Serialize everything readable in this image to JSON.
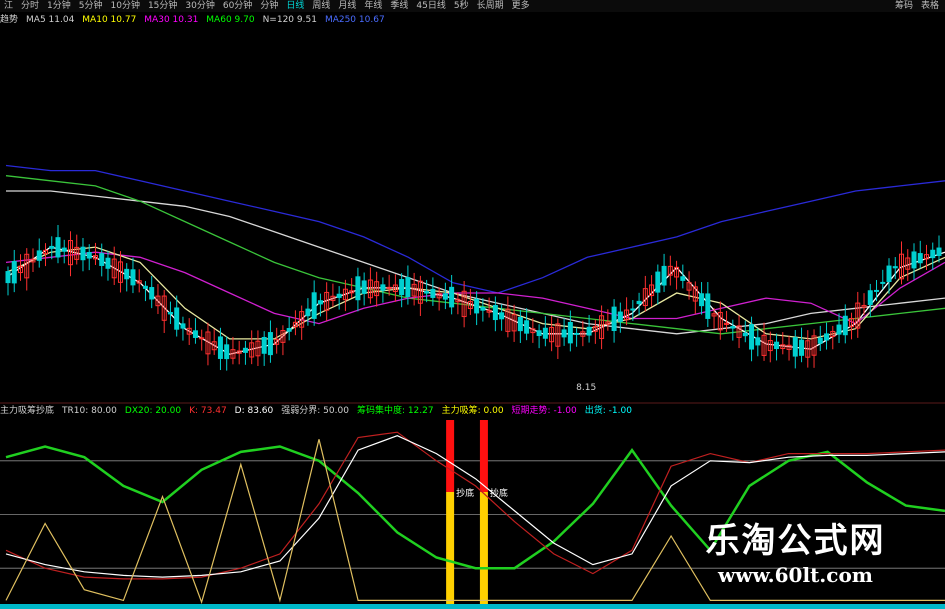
{
  "toolbar": {
    "items": [
      "江",
      "分时",
      "1分钟",
      "5分钟",
      "10分钟",
      "15分钟",
      "30分钟",
      "60分钟",
      "分钟",
      "日线",
      "周线",
      "月线",
      "年线",
      "季线",
      "45日线",
      "5秒",
      "长周期",
      "更多"
    ],
    "active_index": 9,
    "right_items": [
      "筹码",
      "表格"
    ]
  },
  "ma_legend": [
    {
      "label": "趋势",
      "color": "#d0d0d0"
    },
    {
      "label": "MA5 11.04",
      "color": "#d0d0d0"
    },
    {
      "label": "MA10 10.77",
      "color": "#ffff00"
    },
    {
      "label": "MA30 10.31",
      "color": "#ff00ff"
    },
    {
      "label": "MA60 9.70",
      "color": "#00ff00"
    },
    {
      "label": "N=120 9.51",
      "color": "#d0d0d0"
    },
    {
      "label": "MA250 10.67",
      "color": "#4a6cff"
    }
  ],
  "indicator_legend": [
    {
      "label": "主力吸筹抄底",
      "color": "#d0d0d0"
    },
    {
      "label": "TR10: 80.00",
      "color": "#d0d0d0"
    },
    {
      "label": "DX20: 20.00",
      "color": "#00ff00"
    },
    {
      "label": "K: 73.47",
      "color": "#ff3030"
    },
    {
      "label": "D: 83.60",
      "color": "#ffffff"
    },
    {
      "label": "强弱分界: 50.00",
      "color": "#d0d0d0"
    },
    {
      "label": "筹码集中度: 12.27",
      "color": "#00ff00"
    },
    {
      "label": "主力吸筹: 0.00",
      "color": "#ffff00"
    },
    {
      "label": "短期走势: -1.00",
      "color": "#ff00ff"
    },
    {
      "label": "出货: -1.00",
      "color": "#00ffff"
    }
  ],
  "chart_data": [
    {
      "type": "candlestick",
      "title": "",
      "annotations": [
        {
          "text": "8.15",
          "x": 62
        }
      ],
      "series": [
        {
          "name": "MA250",
          "color": "#2a2ad8",
          "values": [
            115,
            114,
            114,
            112,
            110,
            108,
            106,
            104,
            101,
            97,
            92,
            90,
            93,
            97,
            99,
            101,
            104,
            106,
            108,
            110,
            111,
            112
          ]
        },
        {
          "name": "N=120",
          "color": "#d8d8d8",
          "values": [
            110,
            110,
            109,
            108,
            107,
            105,
            102,
            99,
            96,
            93,
            90,
            88,
            86,
            84,
            83,
            82,
            83,
            84,
            86,
            87,
            88,
            89
          ]
        },
        {
          "name": "MA60",
          "color": "#3ac43a",
          "values": [
            113,
            112,
            111,
            108,
            104,
            100,
            96,
            93,
            91,
            89,
            88,
            87,
            86,
            85,
            84,
            83,
            82,
            83,
            84,
            85,
            86,
            87
          ]
        },
        {
          "name": "MA30",
          "color": "#d020d0",
          "values": [
            96,
            97,
            98,
            97,
            94,
            90,
            86,
            84,
            87,
            89,
            90,
            90,
            89,
            87,
            85,
            85,
            87,
            89,
            88,
            84,
            91,
            96
          ]
        },
        {
          "name": "MA10",
          "color": "#e8e8a0",
          "values": [
            94,
            98,
            99,
            96,
            87,
            81,
            81,
            86,
            90,
            91,
            90,
            87,
            84,
            83,
            85,
            90,
            88,
            82,
            81,
            83,
            93,
            97
          ]
        },
        {
          "name": "MA5",
          "color": "#ffffff",
          "values": [
            93,
            99,
            97,
            92,
            83,
            78,
            80,
            88,
            91,
            91,
            89,
            86,
            82,
            82,
            86,
            95,
            85,
            80,
            79,
            84,
            95,
            98
          ]
        }
      ]
    },
    {
      "type": "line",
      "title": "",
      "annotations": [
        {
          "text": "抄底",
          "x": 61
        },
        {
          "text": "抄底",
          "x": 70
        }
      ],
      "ylim": [
        0,
        100
      ],
      "series": [
        {
          "name": "筹码集中度",
          "color": "#20d020",
          "values": [
            82,
            88,
            82,
            66,
            57,
            75,
            85,
            88,
            80,
            62,
            40,
            26,
            20,
            20,
            35,
            56,
            86,
            55,
            30,
            66,
            80,
            85,
            68,
            55,
            52
          ]
        },
        {
          "name": "K",
          "color": "#c02020",
          "values": [
            30,
            20,
            15,
            14,
            14,
            15,
            20,
            28,
            56,
            93,
            96,
            80,
            66,
            46,
            28,
            17,
            30,
            77,
            84,
            79,
            84,
            84,
            84,
            85,
            86
          ]
        },
        {
          "name": "D",
          "color": "#ffffff",
          "values": [
            28,
            22,
            18,
            16,
            15,
            16,
            18,
            24,
            48,
            86,
            94,
            84,
            70,
            52,
            34,
            22,
            28,
            66,
            80,
            79,
            82,
            83,
            83,
            84,
            85
          ]
        },
        {
          "name": "主力吸筹",
          "color": "#e0c060",
          "values": [
            2,
            45,
            8,
            2,
            60,
            1,
            78,
            2,
            92,
            2,
            2,
            2,
            2,
            2,
            2,
            2,
            2,
            38,
            2,
            2,
            2,
            2,
            2,
            2,
            2
          ]
        },
        {
          "name": "出货",
          "color": "#00c0c0",
          "values": [
            -1,
            -1,
            -1,
            -1,
            -1,
            -1,
            -1,
            -1,
            -1,
            -1,
            -1,
            -1,
            -1,
            -1,
            -1,
            -1,
            -1,
            -1,
            -1,
            -1,
            -1,
            -1,
            -1,
            -1,
            -1
          ]
        }
      ],
      "reference_lines": [
        50,
        80,
        20
      ]
    }
  ],
  "watermark": {
    "title": "乐淘公式网",
    "url": "www.60lt.com"
  }
}
